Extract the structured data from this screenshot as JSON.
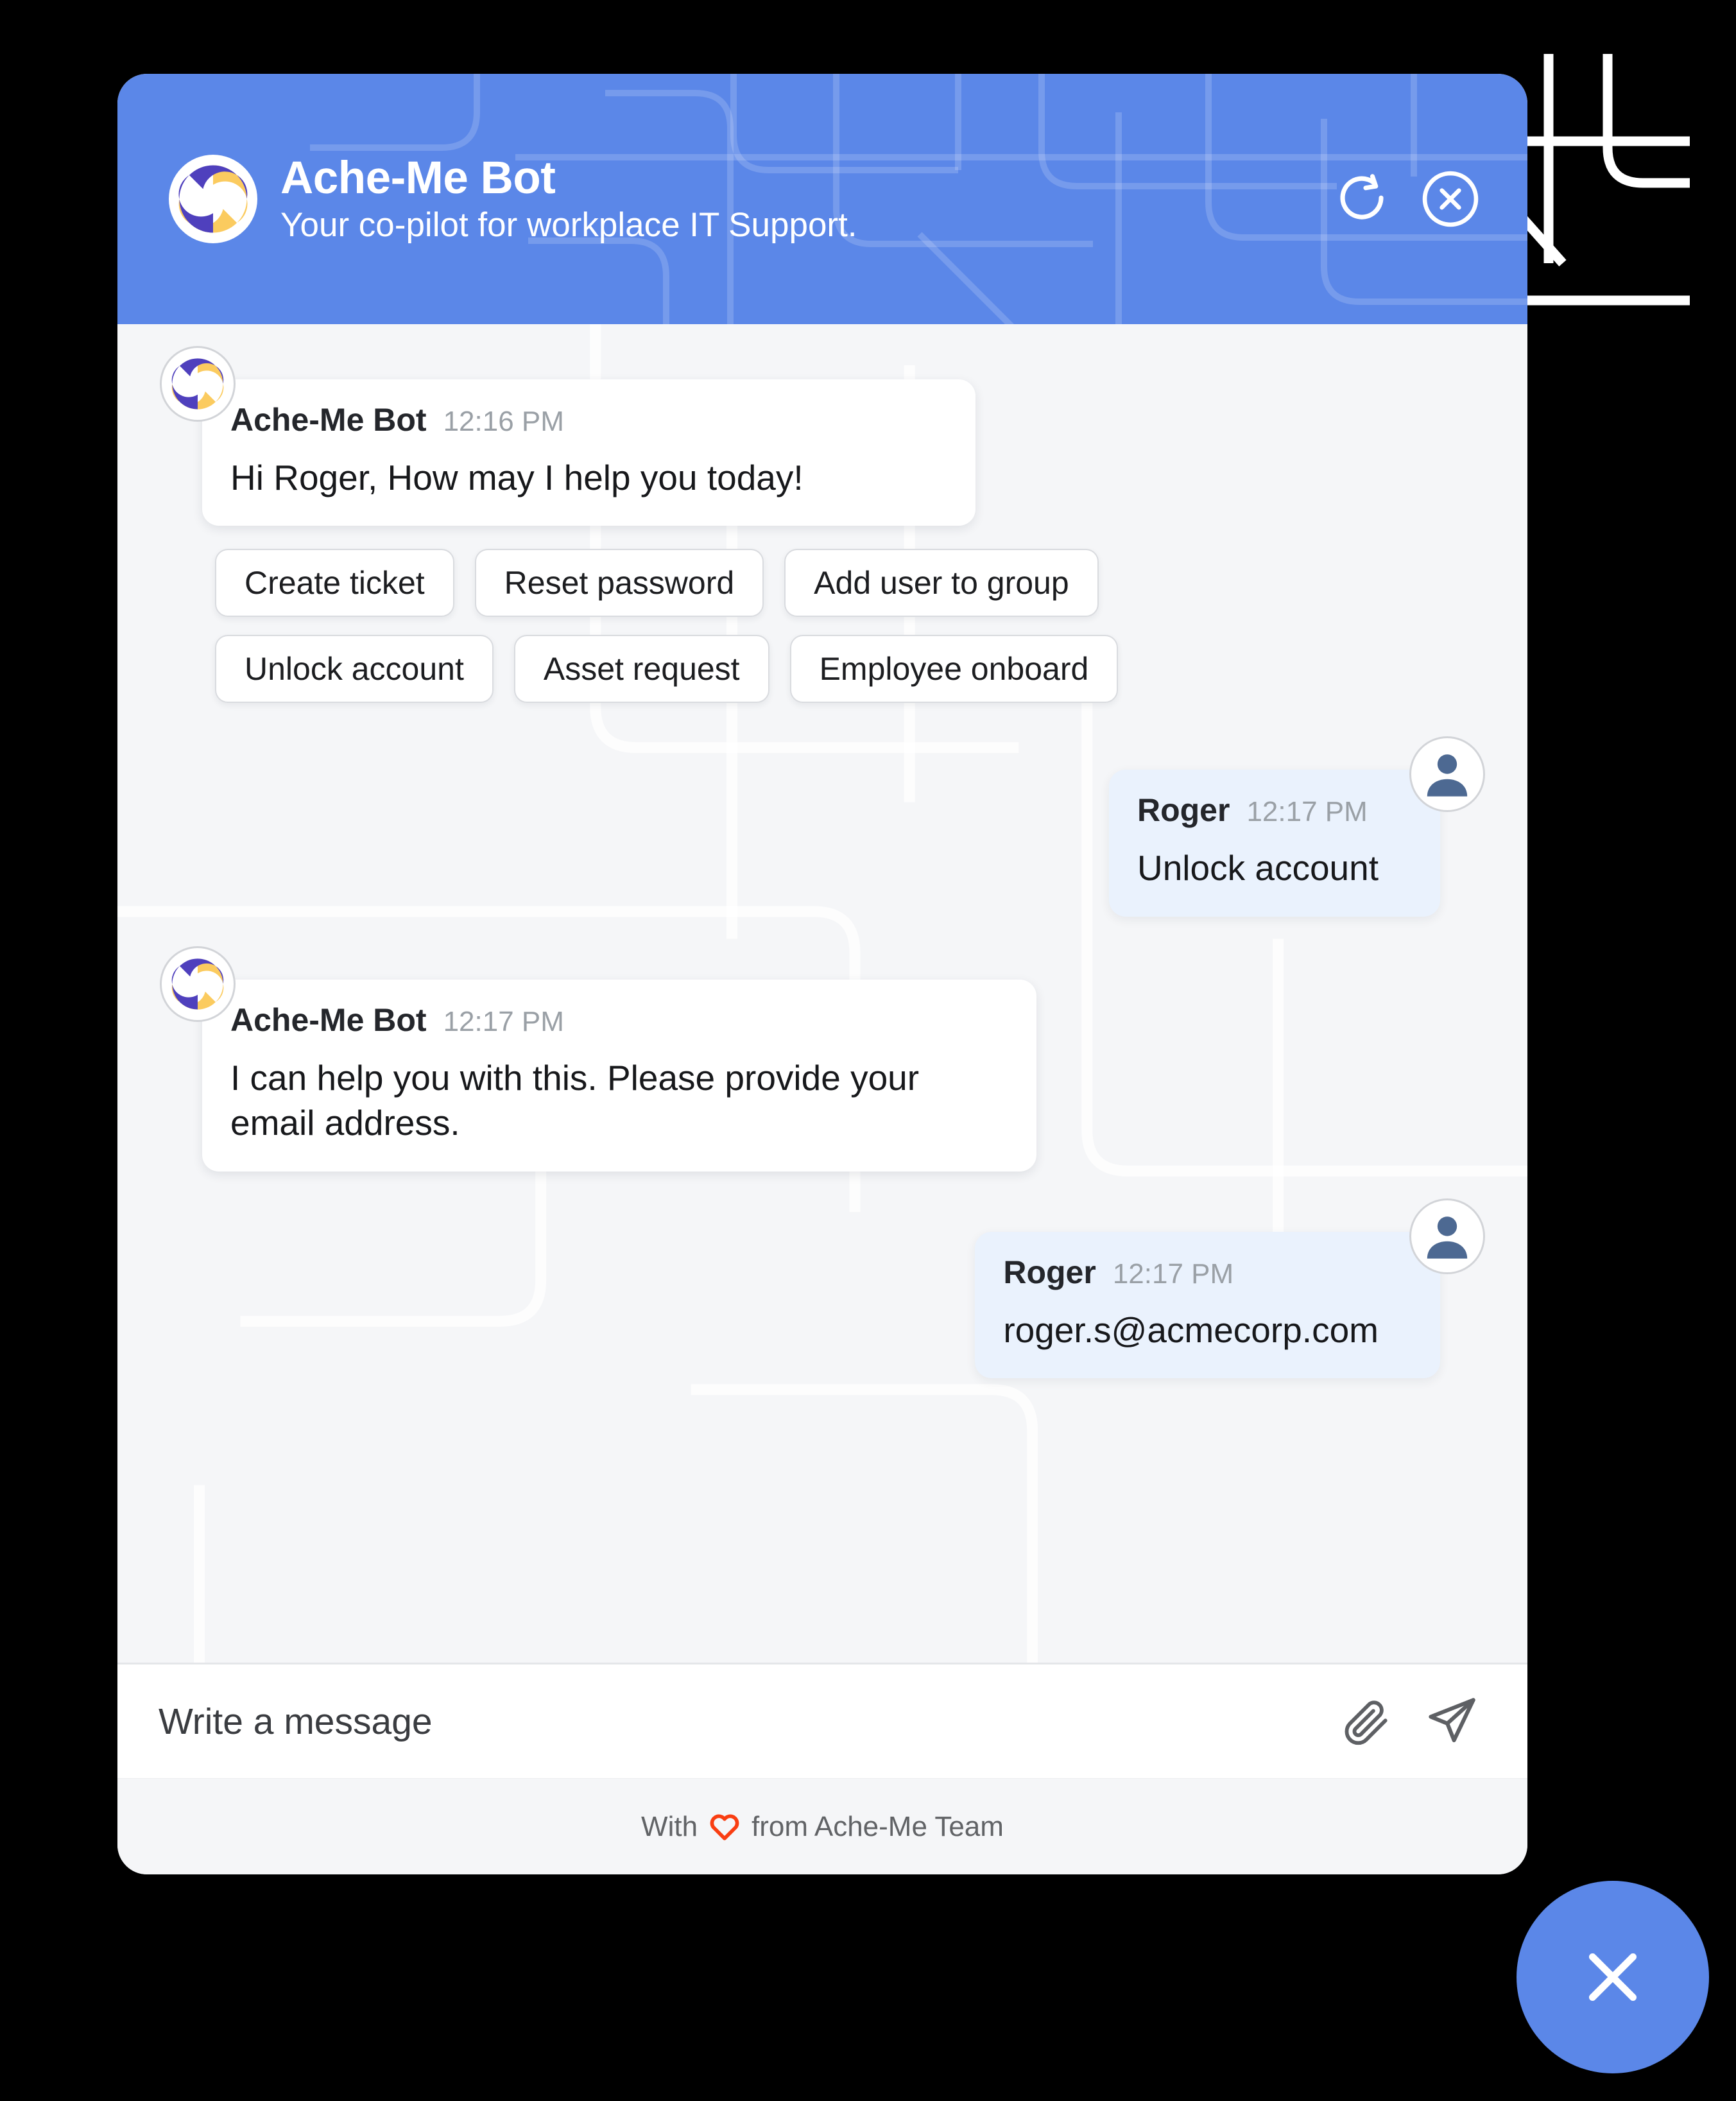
{
  "window": {
    "card_background": "#F5F6F8",
    "page_background": "#000000"
  },
  "header": {
    "title": "Ache-Me Bot",
    "subtitle": "Your co-pilot for workplace IT Support.",
    "accent_color": "#5B87E8",
    "logo_colors": {
      "purple": "#4F40BD",
      "yellow": "#FBCB5F",
      "ring": "#FFFFFF"
    },
    "actions": [
      {
        "name": "refresh-button",
        "icon": "refresh-icon",
        "label": "Refresh"
      },
      {
        "name": "close-button",
        "icon": "close-circle-icon",
        "label": "Close"
      }
    ]
  },
  "conversation": {
    "messages": [
      {
        "role": "bot",
        "sender": "Ache-Me Bot",
        "time": "12:16 PM",
        "text": "Hi Roger, How may I help you today!"
      },
      {
        "role": "user",
        "sender": "Roger",
        "time": "12:17 PM",
        "text": "Unlock account"
      },
      {
        "role": "bot",
        "sender": "Ache-Me Bot",
        "time": "12:17 PM",
        "text": "I can help you with this. Please provide your email address."
      },
      {
        "role": "user",
        "sender": "Roger",
        "time": "12:17 PM",
        "text": "roger.s@acmecorp.com"
      }
    ],
    "bubble_colors": {
      "bot": "#FFFFFF",
      "user": "#EAF2FD"
    }
  },
  "quick_replies": [
    {
      "label": "Create ticket"
    },
    {
      "label": "Reset password"
    },
    {
      "label": "Add user to group"
    },
    {
      "label": "Unlock account"
    },
    {
      "label": "Asset request"
    },
    {
      "label": "Employee onboard"
    }
  ],
  "composer": {
    "placeholder": "Write a message",
    "value": "",
    "attach_icon": "paperclip-icon",
    "send_icon": "paper-plane-icon"
  },
  "footer": {
    "prefix": "With",
    "suffix": "from Ache-Me Team",
    "heart_color": "#F93E12"
  },
  "fab": {
    "icon": "close-icon",
    "color": "#5B87E8",
    "label": "Close chat"
  }
}
